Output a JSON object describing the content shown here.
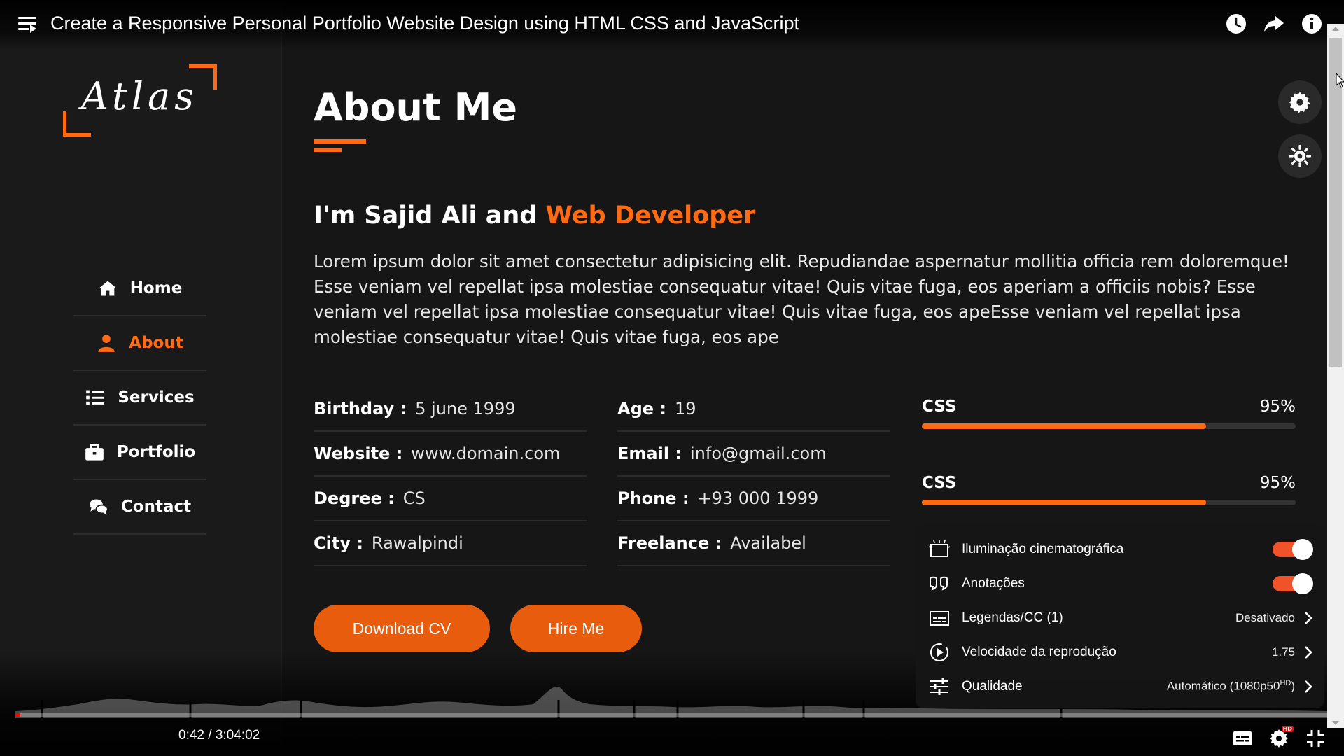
{
  "player": {
    "title": "Create a Responsive Personal Portfolio Website Design using HTML CSS and JavaScript",
    "time_current": "0:42",
    "time_total": "3:04:02",
    "time_display": "0:42 / 3:04:02",
    "progress": 0.004,
    "hd_badge": "HD",
    "top_icons": [
      "watch-later-icon",
      "share-icon",
      "info-icon"
    ],
    "bottom_icons": [
      "subtitles-icon",
      "settings-icon",
      "exit-fullscreen-icon"
    ]
  },
  "sidebar": {
    "logo": "Atlas",
    "items": [
      {
        "label": "Home",
        "icon": "home-icon",
        "active": false
      },
      {
        "label": "About",
        "icon": "user-icon",
        "active": true
      },
      {
        "label": "Services",
        "icon": "list-icon",
        "active": false
      },
      {
        "label": "Portfolio",
        "icon": "briefcase-icon",
        "active": false
      },
      {
        "label": "Contact",
        "icon": "comments-icon",
        "active": false
      }
    ]
  },
  "main": {
    "heading": "About Me",
    "intro_plain": "I'm Sajid Ali and ",
    "intro_accent": "Web Developer",
    "paragraph": "Lorem ipsum dolor sit amet consectetur adipisicing elit. Repudiandae aspernatur mollitia officia rem doloremque! Esse veniam vel repellat ipsa molestiae consequatur vitae! Quis vitae fuga, eos aperiam a officiis nobis? Esse veniam vel repellat ipsa molestiae consequatur vitae! Quis vitae fuga, eos apeEsse veniam vel repellat ipsa molestiae consequatur vitae! Quis vitae fuga, eos ape",
    "info_left": [
      {
        "key": "Birthday :",
        "value": "5 june 1999"
      },
      {
        "key": "Website :",
        "value": "www.domain.com"
      },
      {
        "key": "Degree :",
        "value": "CS"
      },
      {
        "key": "City :",
        "value": "Rawalpindi"
      }
    ],
    "info_right": [
      {
        "key": "Age :",
        "value": "19"
      },
      {
        "key": "Email :",
        "value": "info@gmail.com"
      },
      {
        "key": "Phone :",
        "value": "+93 000 1999"
      },
      {
        "key": "Freelance :",
        "value": "Availabel"
      }
    ],
    "buttons": {
      "download": "Download CV",
      "hire": "Hire Me"
    },
    "skills": [
      {
        "label": "CSS",
        "percent": "95%",
        "value": 0.76
      },
      {
        "label": "CSS",
        "percent": "95%",
        "value": 0.76
      }
    ],
    "side_buttons": [
      "gear-icon",
      "sun-icon"
    ]
  },
  "settings_panel": {
    "rows": [
      {
        "label": "Iluminação cinematográfica",
        "icon": "ambient-mode-icon",
        "toggle": true
      },
      {
        "label": "Anotações",
        "icon": "annotations-icon",
        "toggle": true
      },
      {
        "label": "Legendas/CC (1)",
        "icon": "captions-icon",
        "value": "Desativado"
      },
      {
        "label": "Velocidade da reprodução",
        "icon": "playback-speed-icon",
        "value": "1.75"
      },
      {
        "label": "Qualidade",
        "icon": "quality-icon",
        "value": "Automático (1080p50",
        "value_sup": "HD",
        "value_end": ")"
      }
    ]
  },
  "colors": {
    "accent": "#ff6a13",
    "toggle_on": "#f0532a",
    "progress_played": "#ff0000"
  }
}
